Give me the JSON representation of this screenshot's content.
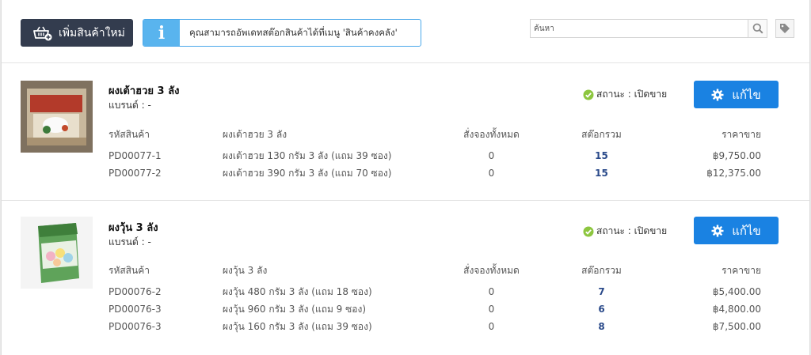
{
  "toolbar": {
    "add_product_label": "เพิ่มสินค้าใหม่",
    "info_icon_glyph": "i",
    "info_text": "คุณสามารถอัพเดทสต๊อกสินค้าได้ที่เมนู 'สินค้าคงคลัง'",
    "search_placeholder": "ค้นหา"
  },
  "colors": {
    "add_button_bg": "#333c4e",
    "info_accent": "#59b4ee",
    "edit_button_bg": "#1a82e2",
    "status_check": "#8dc63f",
    "stock_number": "#2a4a8a"
  },
  "columns": {
    "sku": "รหัสสินค้า",
    "booked": "สั่งจองทั้งหมด",
    "stock": "สต๊อกรวม",
    "price": "ราคาขาย"
  },
  "products": [
    {
      "name": "ผงเต้าฮวย 3 ลัง",
      "brand": "แบรนด์ : -",
      "status": "สถานะ : เปิดขาย",
      "edit_label": "แก้ไข",
      "variant_header": "ผงเต้าฮวย 3 ลัง",
      "variants": [
        {
          "sku": "PD00077-1",
          "name": "ผงเต้าฮวย 130 กรัม 3 ลัง (แถม 39 ซอง)",
          "booked": "0",
          "stock": "15",
          "price": "฿9,750.00"
        },
        {
          "sku": "PD00077-2",
          "name": "ผงเต้าฮวย 390 กรัม 3 ลัง (แถม 70 ซอง)",
          "booked": "0",
          "stock": "15",
          "price": "฿12,375.00"
        }
      ]
    },
    {
      "name": "ผงวุ้น 3 ลัง",
      "brand": "แบรนด์ : -",
      "status": "สถานะ : เปิดขาย",
      "edit_label": "แก้ไข",
      "variant_header": "ผงวุ้น 3 ลัง",
      "variants": [
        {
          "sku": "PD00076-2",
          "name": "ผงวุ้น 480 กรัม 3 ลัง (แถม 18 ซอง)",
          "booked": "0",
          "stock": "7",
          "price": "฿5,400.00"
        },
        {
          "sku": "PD00076-3",
          "name": "ผงวุ้น 960 กรัม 3 ลัง (แถม 9 ซอง)",
          "booked": "0",
          "stock": "6",
          "price": "฿4,800.00"
        },
        {
          "sku": "PD00076-3",
          "name": "ผงวุ้น 160 กรัม 3 ลัง (แถม 39 ซอง)",
          "booked": "0",
          "stock": "8",
          "price": "฿7,500.00"
        }
      ]
    }
  ]
}
